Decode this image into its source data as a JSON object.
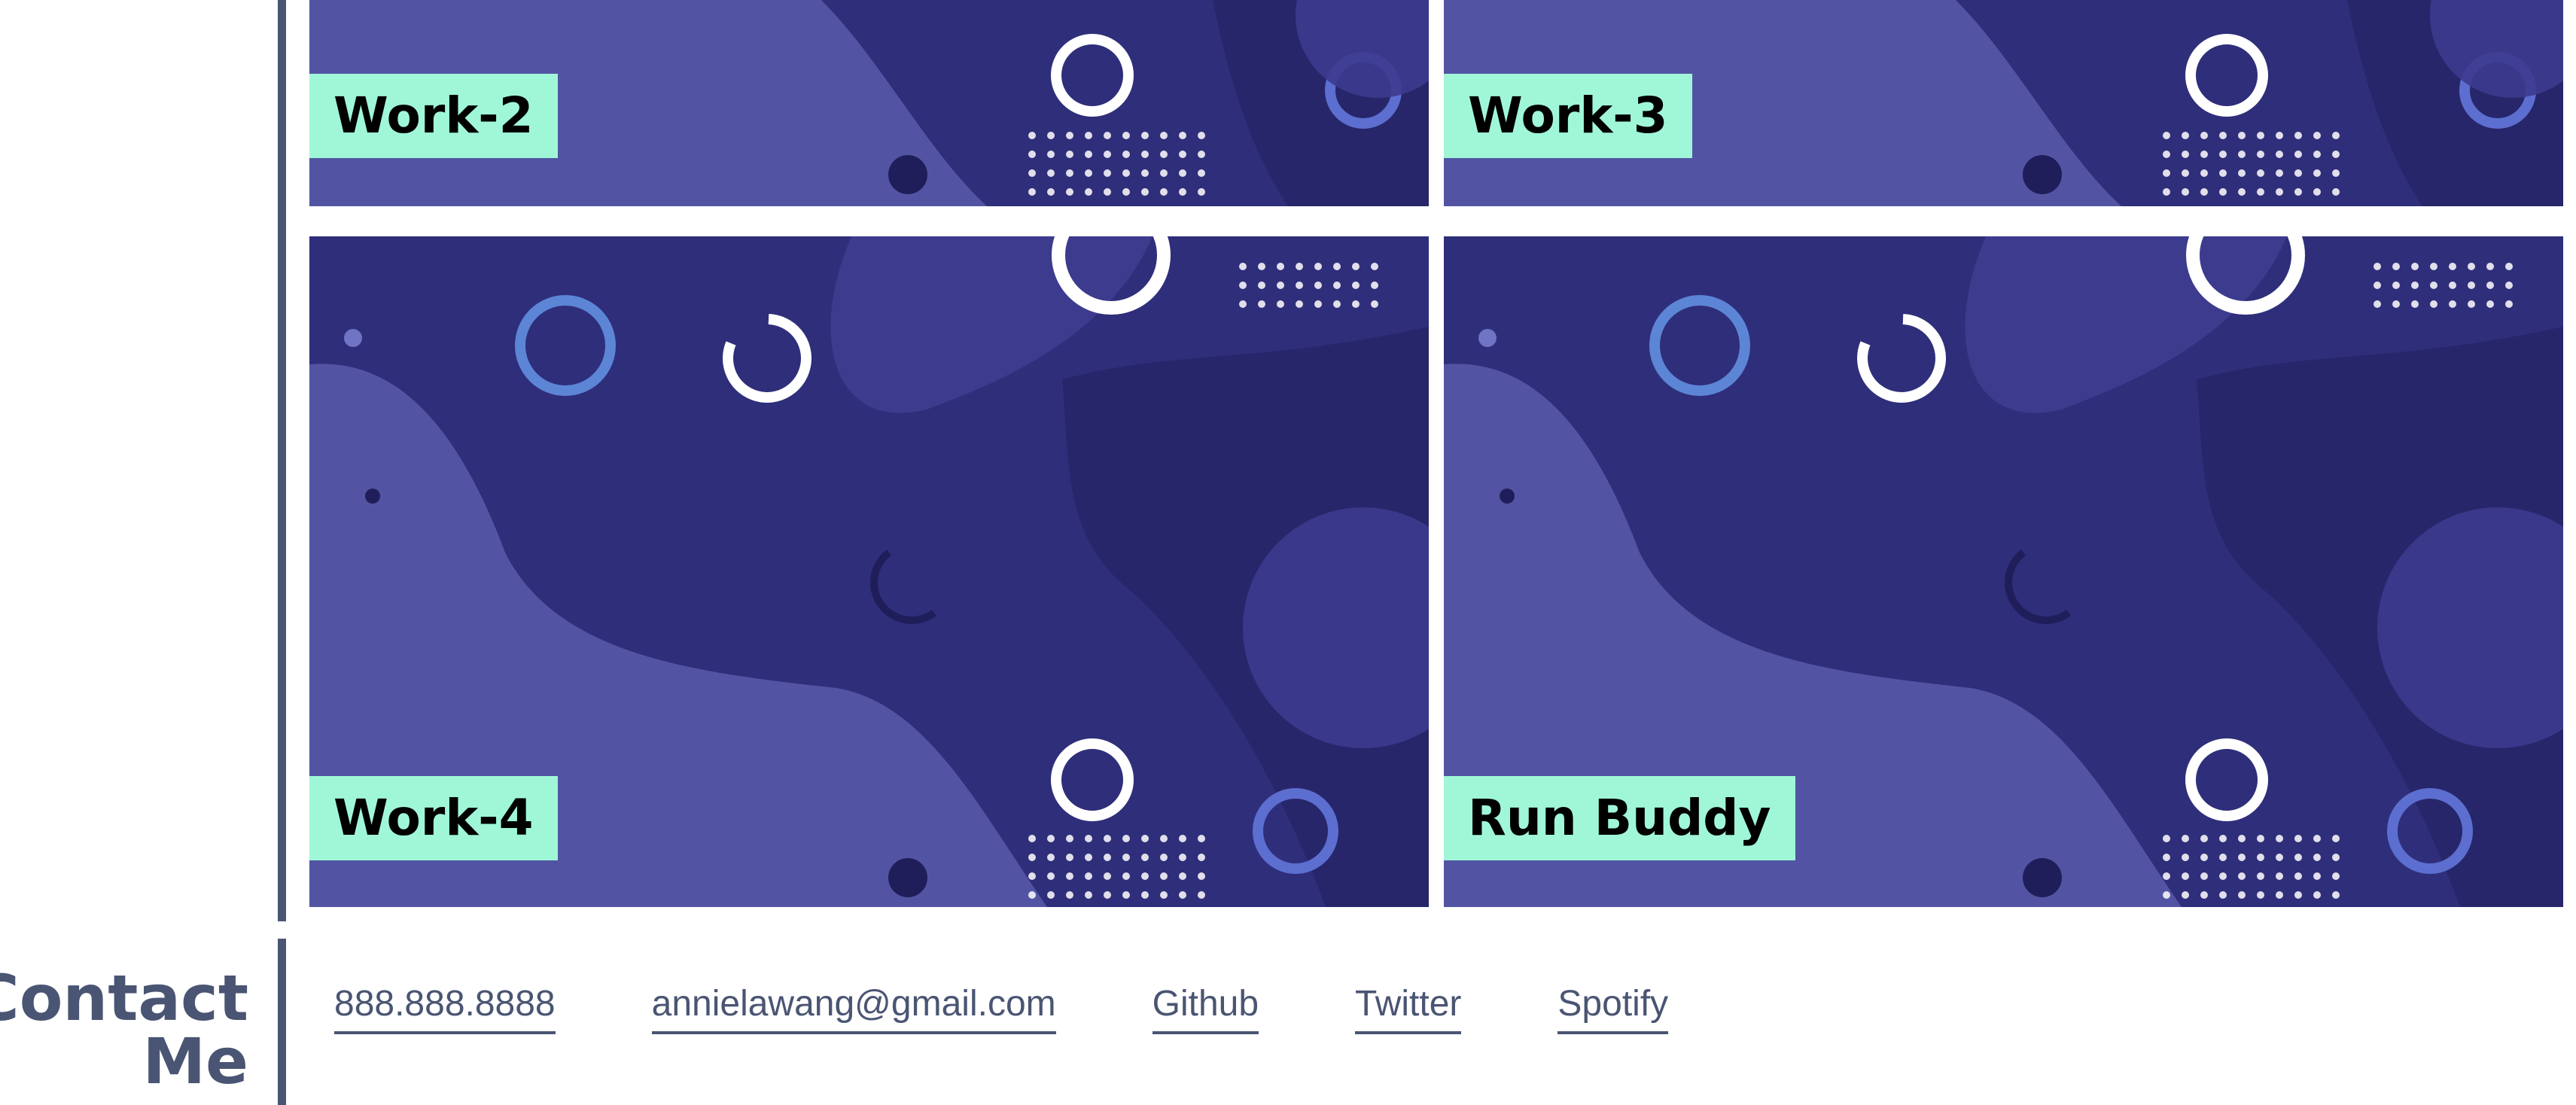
{
  "work": {
    "cards": [
      {
        "label": "Work-2"
      },
      {
        "label": "Work-3"
      },
      {
        "label": "Work-4"
      },
      {
        "label": "Run Buddy"
      }
    ]
  },
  "contact": {
    "heading_line1": "Contact",
    "heading_line2": "Me",
    "links": [
      {
        "label": "888.888.8888"
      },
      {
        "label": "annielawang@gmail.com"
      },
      {
        "label": "Github"
      },
      {
        "label": "Twitter"
      },
      {
        "label": "Spotify"
      }
    ]
  },
  "colors": {
    "accent_label_bg": "#a0f7d8",
    "heading": "#4a5573",
    "card_dark": "#2f2e7a",
    "card_light": "#5254a3"
  }
}
